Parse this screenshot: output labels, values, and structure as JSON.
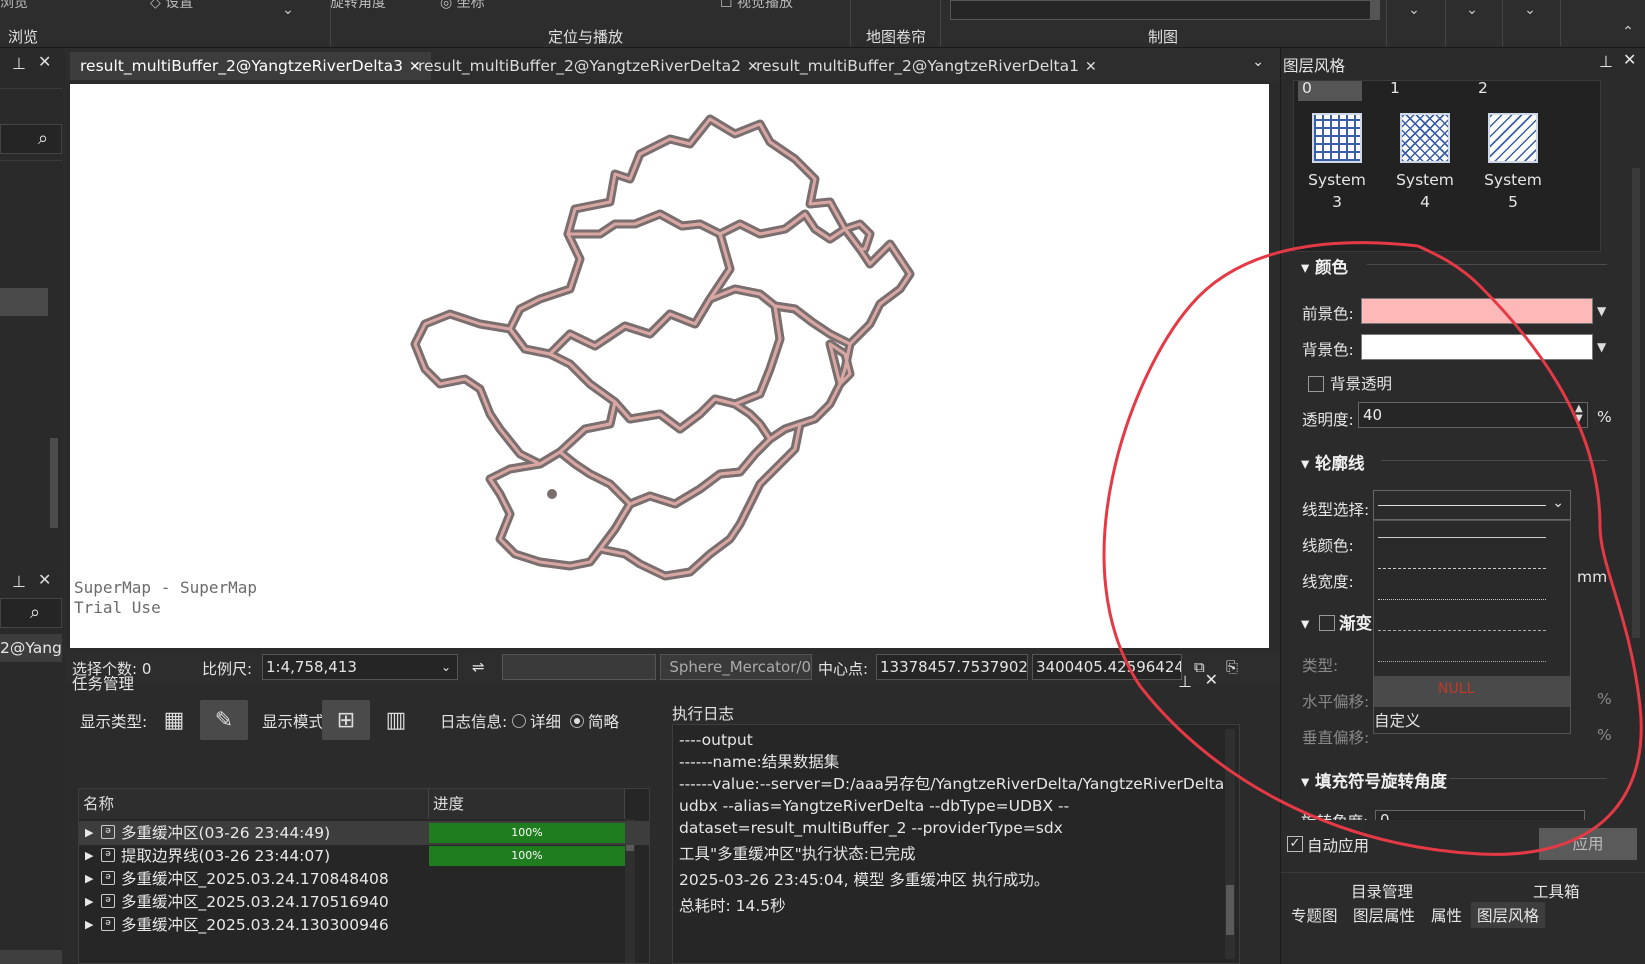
{
  "ribbon": {
    "groups": [
      "浏览",
      "定位与播放",
      "地图卷帘",
      "制图"
    ]
  },
  "left": {
    "tree_item_partial": "2@Yang"
  },
  "tabs": [
    {
      "label": "result_multiBuffer_2@YangtzeRiverDelta3",
      "active": true
    },
    {
      "label": "result_multiBuffer_2@YangtzeRiverDelta2",
      "active": false
    },
    {
      "label": "result_multiBuffer_2@YangtzeRiverDelta1",
      "active": false
    }
  ],
  "map": {
    "watermark_line1": "SuperMap - SuperMap",
    "watermark_line2": "Trial Use",
    "fill_color": "#d9a7a3",
    "stroke_color": "#7a6e6e"
  },
  "status": {
    "selected_count": "选择个数: 0",
    "scale_label": "比例尺:",
    "scale_value": "1:4,758,413",
    "projection": "0/Sphere_Mercator",
    "center_label": "中心点:",
    "center_x": "13378457.75379027",
    "center_y": "3400405.42596424"
  },
  "task": {
    "title": "任务管理",
    "display_type": "显示类型:",
    "display_mode": "显示模式:",
    "log_info": "日志信息:",
    "detail": "详细",
    "brief": "简略",
    "col_name": "名称",
    "col_progress": "进度",
    "rows": [
      {
        "name": "多重缓冲区(03-26 23:44:49)",
        "progress": "100%"
      },
      {
        "name": "提取边界线(03-26 23:44:07)",
        "progress": "100%"
      },
      {
        "name": "多重缓冲区_2025.03.24.170848408",
        "progress": ""
      },
      {
        "name": "多重缓冲区_2025.03.24.170516940",
        "progress": ""
      },
      {
        "name": "多重缓冲区_2025.03.24.130300946",
        "progress": ""
      }
    ],
    "log_title": "执行日志",
    "log_lines": [
      "----output",
      "------name:结果数据集",
      "------value:--server=D:/aaa另存包/YangtzeRiverDelta/YangtzeRiverDelta.",
      "udbx --alias=YangtzeRiverDelta --dbType=UDBX --",
      "dataset=result_multiBuffer_2 --providerType=sdx",
      "工具\"多重缓冲区\"执行状态:已完成",
      "2025-03-26 23:45:04, 模型 多重缓冲区 执行成功。",
      "总耗时: 14.5秒"
    ]
  },
  "style_panel": {
    "title": "图层风格",
    "top_nums": [
      "0",
      "1",
      "2"
    ],
    "systems": [
      {
        "line1": "System",
        "line2": "3"
      },
      {
        "line1": "System",
        "line2": "4"
      },
      {
        "line1": "System",
        "line2": "5"
      }
    ],
    "color_section": "颜色",
    "fg_label": "前景色:",
    "bg_label": "背景色:",
    "fg_color": "#ffb8b8",
    "bg_color": "#ffffff",
    "bg_transparent": "背景透明",
    "opacity_label": "透明度:",
    "opacity_value": "40",
    "percent": "%",
    "outline_section": "轮廓线",
    "linetype_label": "线型选择:",
    "linecolor_label": "线颜色:",
    "linewidth_label": "线宽度:",
    "mm": "mm",
    "gradient_section": "渐变",
    "type_label": "类型:",
    "hoffset_label": "水平偏移:",
    "voffset_label": "垂直偏移:",
    "null_item": "NULL",
    "custom_item": "自定义",
    "rotation_section": "填充符号旋转角度",
    "rotation_label": "旋转角度:",
    "rotation_value": "0",
    "auto_apply": "自动应用",
    "apply": "应用",
    "bottom_tabs_row1": [
      "目录管理",
      "工具箱"
    ],
    "bottom_tabs_row2": [
      "专题图",
      "图层属性",
      "属性",
      "图层风格"
    ]
  }
}
